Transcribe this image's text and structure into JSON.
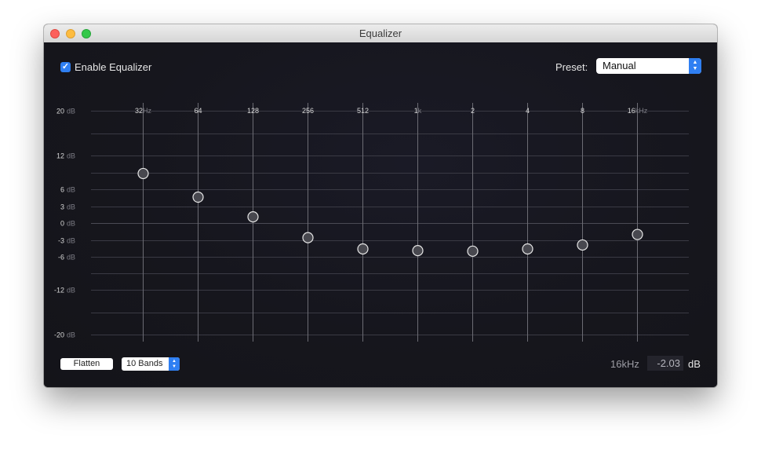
{
  "window": {
    "title": "Equalizer"
  },
  "controls": {
    "enable_label": "Enable Equalizer",
    "enable_checked": true,
    "preset_label": "Preset:",
    "preset_value": "Manual",
    "flatten_label": "Flatten",
    "bands_value": "10 Bands"
  },
  "db_scale": [
    {
      "num": "20",
      "unit": "dB",
      "value": 20
    },
    {
      "num": "12",
      "unit": "dB",
      "value": 12
    },
    {
      "num": "6",
      "unit": "dB",
      "value": 6
    },
    {
      "num": "3",
      "unit": "dB",
      "value": 3
    },
    {
      "num": "0",
      "unit": "dB",
      "value": 0
    },
    {
      "num": "-3",
      "unit": "dB",
      "value": -3
    },
    {
      "num": "-6",
      "unit": "dB",
      "value": -6
    },
    {
      "num": "-12",
      "unit": "dB",
      "value": -12
    },
    {
      "num": "-20",
      "unit": "dB",
      "value": -20
    }
  ],
  "bands": [
    {
      "num": "32",
      "unit": "Hz",
      "gain": 8.8
    },
    {
      "num": "64",
      "unit": "",
      "gain": 4.6
    },
    {
      "num": "128",
      "unit": "",
      "gain": 1.1
    },
    {
      "num": "256",
      "unit": "",
      "gain": -2.6
    },
    {
      "num": "512",
      "unit": "",
      "gain": -4.6
    },
    {
      "num": "1",
      "unit": "k",
      "gain": -4.9
    },
    {
      "num": "2",
      "unit": "",
      "gain": -5.0
    },
    {
      "num": "4",
      "unit": "",
      "gain": -4.6
    },
    {
      "num": "8",
      "unit": "",
      "gain": -3.9
    },
    {
      "num": "16",
      "unit": "kHz",
      "gain": -2.03
    }
  ],
  "readout": {
    "frequency": "16kHz",
    "gain": "-2.03",
    "unit": "dB"
  },
  "colors": {
    "accent": "#2f7ff2",
    "background": "#16161d"
  }
}
